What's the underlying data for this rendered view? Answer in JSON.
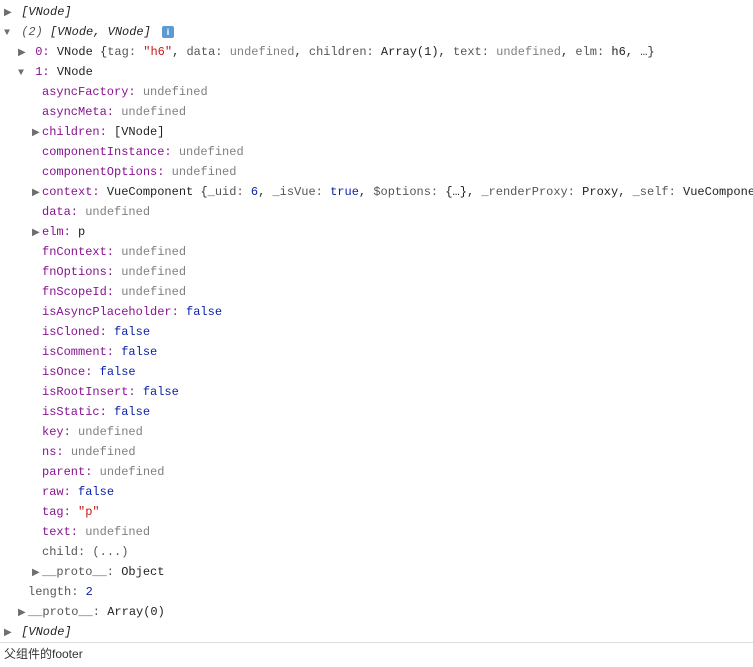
{
  "top": {
    "vnode_label": "[VNode]"
  },
  "array": {
    "header_count": "(2)",
    "header_types": "[VNode, VNode]",
    "item0_prefix": "0:",
    "item0_type": "VNode",
    "item0_summary_open": "{",
    "item0_tag_key": "tag:",
    "item0_tag_val": "\"h6\"",
    "item0_data_key": "data:",
    "item0_data_val": "undefined",
    "item0_children_key": "children:",
    "item0_children_val": "Array(1)",
    "item0_text_key": "text:",
    "item0_text_val": "undefined",
    "item0_elm_key": "elm:",
    "item0_elm_val": "h6",
    "item0_summary_close": ", …}",
    "item1_prefix": "1:",
    "item1_type": "VNode",
    "length_key": "length:",
    "length_val": "2",
    "proto_key": "__proto__:",
    "proto_val": "Array(0)"
  },
  "props": {
    "asyncFactory_k": "asyncFactory:",
    "asyncFactory_v": "undefined",
    "asyncMeta_k": "asyncMeta:",
    "asyncMeta_v": "undefined",
    "children_k": "children:",
    "children_v": "[VNode]",
    "componentInstance_k": "componentInstance:",
    "componentInstance_v": "undefined",
    "componentOptions_k": "componentOptions:",
    "componentOptions_v": "undefined",
    "context_k": "context:",
    "context_type": "VueComponent",
    "context_open": "{",
    "context_uid_k": "_uid:",
    "context_uid_v": "6",
    "context_isVue_k": "_isVue:",
    "context_isVue_v": "true",
    "context_options_k": "$options:",
    "context_options_v": "{…}",
    "context_renderProxy_k": "_renderProxy:",
    "context_renderProxy_v": "Proxy",
    "context_self_k": "_self:",
    "context_self_v": "VueComponent",
    "context_close": ", …}",
    "data_k": "data:",
    "data_v": "undefined",
    "elm_k": "elm:",
    "elm_v": "p",
    "fnContext_k": "fnContext:",
    "fnContext_v": "undefined",
    "fnOptions_k": "fnOptions:",
    "fnOptions_v": "undefined",
    "fnScopeId_k": "fnScopeId:",
    "fnScopeId_v": "undefined",
    "isAsyncPlaceholder_k": "isAsyncPlaceholder:",
    "isAsyncPlaceholder_v": "false",
    "isCloned_k": "isCloned:",
    "isCloned_v": "false",
    "isComment_k": "isComment:",
    "isComment_v": "false",
    "isOnce_k": "isOnce:",
    "isOnce_v": "false",
    "isRootInsert_k": "isRootInsert:",
    "isRootInsert_v": "false",
    "isStatic_k": "isStatic:",
    "isStatic_v": "false",
    "key_k": "key:",
    "key_v": "undefined",
    "ns_k": "ns:",
    "ns_v": "undefined",
    "parent_k": "parent:",
    "parent_v": "undefined",
    "raw_k": "raw:",
    "raw_v": "false",
    "tag_k": "tag:",
    "tag_v": "\"p\"",
    "text_k": "text:",
    "text_v": "undefined",
    "child_k": "child:",
    "child_v": "(...)",
    "proto_k": "__proto__:",
    "proto_v": "Object"
  },
  "bottom": {
    "vnode_label": "[VNode]"
  },
  "footer": {
    "text": "父组件的footer"
  }
}
